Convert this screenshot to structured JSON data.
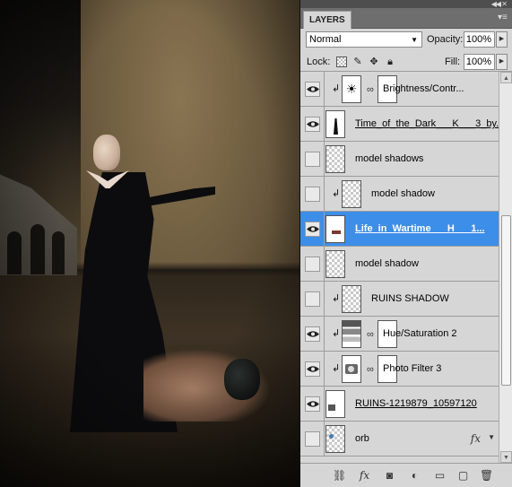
{
  "panel": {
    "collapse_icon": "collapse-arrows-icon",
    "tab_label": "LAYERS",
    "menu_icon": "panel-menu-icon"
  },
  "blend": {
    "mode": "Normal",
    "opacity_label": "Opacity:",
    "opacity_value": "100%",
    "lock_label": "Lock:",
    "fill_label": "Fill:",
    "fill_value": "100%"
  },
  "layers": [
    {
      "name": "Brightness/Contr...",
      "visible": true,
      "clipped": true,
      "thumb": "brightness-adjustment",
      "mask": true,
      "selected": false
    },
    {
      "name": "Time_of_the_Dark___K___3_by...",
      "visible": true,
      "clipped": false,
      "thumb": "dark-figure",
      "mask": false,
      "selected": false
    },
    {
      "name": "model shadows",
      "visible": false,
      "clipped": false,
      "thumb": "transparent",
      "mask": false,
      "selected": false
    },
    {
      "name": "model shadow",
      "visible": false,
      "clipped": true,
      "thumb": "transparent",
      "mask": false,
      "selected": false
    },
    {
      "name": "Life_in_Wartime___H___1...",
      "visible": true,
      "clipped": false,
      "thumb": "wartime",
      "mask": false,
      "selected": true
    },
    {
      "name": "model shadow",
      "visible": false,
      "clipped": false,
      "thumb": "transparent",
      "mask": false,
      "selected": false
    },
    {
      "name": "RUINS SHADOW",
      "visible": false,
      "clipped": true,
      "thumb": "transparent",
      "mask": false,
      "selected": false
    },
    {
      "name": "Hue/Saturation 2",
      "visible": true,
      "clipped": true,
      "thumb": "hue-saturation-adjustment",
      "mask": true,
      "selected": false
    },
    {
      "name": "Photo Filter 3",
      "visible": true,
      "clipped": true,
      "thumb": "photo-filter-adjustment",
      "mask": true,
      "selected": false
    },
    {
      "name": "RUINS-1219879_10597120",
      "visible": true,
      "clipped": false,
      "thumb": "ruins",
      "mask": false,
      "selected": false
    },
    {
      "name": "orb",
      "visible": false,
      "clipped": false,
      "thumb": "orb",
      "mask": false,
      "selected": false,
      "fx": "fx"
    }
  ],
  "footer_icons": [
    "link-layers-icon",
    "layer-style-fx-icon",
    "add-mask-icon",
    "adjustment-layer-icon",
    "new-group-icon",
    "new-layer-icon",
    "trash-icon"
  ],
  "colors": {
    "selected_row": "#3d8ee8",
    "panel_bg": "#d6d6d6"
  }
}
